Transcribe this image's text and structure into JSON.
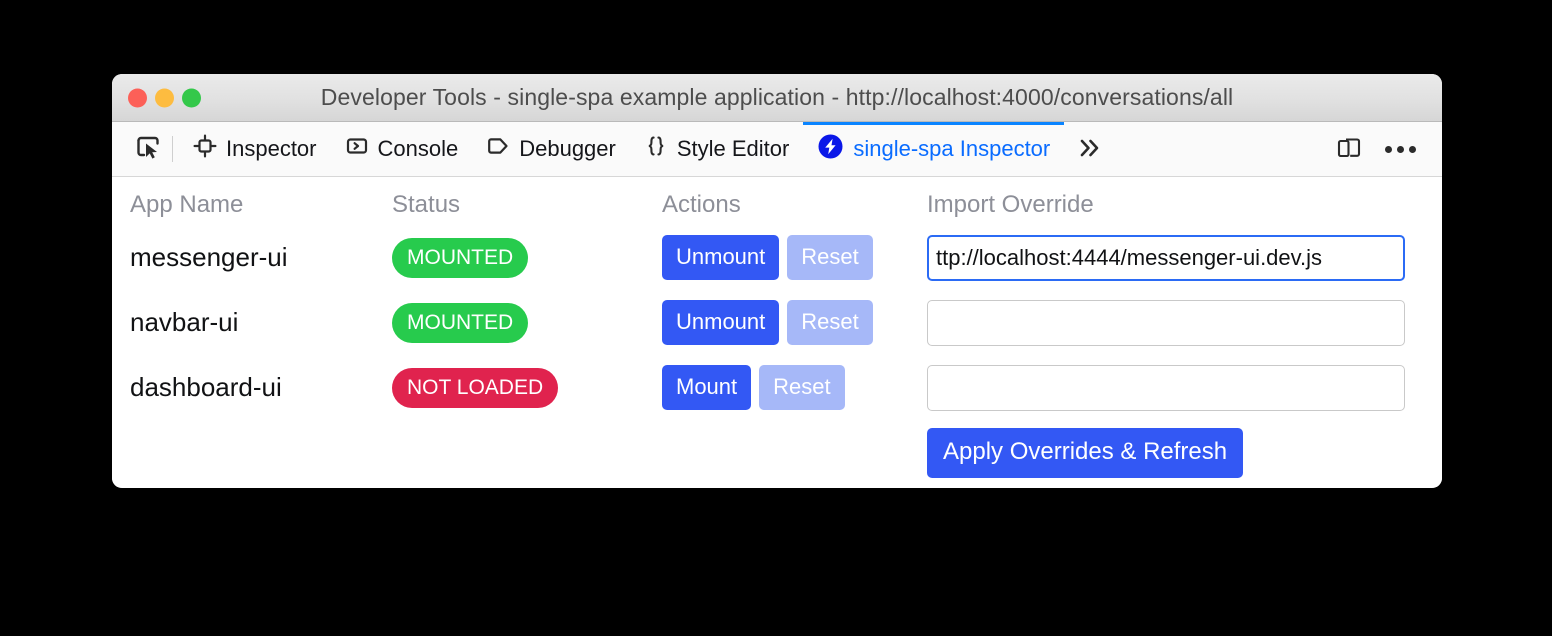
{
  "window": {
    "title": "Developer Tools - single-spa example application - http://localhost:4000/conversations/all",
    "traffic_lights": {
      "close": "close-window",
      "minimize": "minimize-window",
      "maximize": "maximize-window"
    },
    "colors": {
      "close": "#fc6058",
      "minimize": "#fdbc40",
      "maximize": "#34c84a",
      "titlebar_top": "#eaeaea",
      "titlebar_bottom": "#d6d6d6"
    }
  },
  "toolbar": {
    "picker_icon": "element-picker-icon",
    "tabs": [
      {
        "label": "Inspector",
        "icon": "inspector-target-icon",
        "active": false
      },
      {
        "label": "Console",
        "icon": "console-chevron-icon",
        "active": false
      },
      {
        "label": "Debugger",
        "icon": "debugger-tag-icon",
        "active": false
      },
      {
        "label": "Style Editor",
        "icon": "style-editor-braces-icon",
        "active": false
      },
      {
        "label": "single-spa Inspector",
        "icon": "single-spa-bolt-icon",
        "active": true
      }
    ],
    "overflow_icon": "double-chevron-right-icon",
    "responsive_icon": "responsive-design-mode-icon",
    "menu_icon": "meatball-menu-icon",
    "active_tab_color": "#0a6cff",
    "active_underline_color": "#0a84ff"
  },
  "table": {
    "headers": {
      "app_name": "App Name",
      "status": "Status",
      "actions": "Actions",
      "import_override": "Import Override"
    },
    "rows": [
      {
        "app_name": "messenger-ui",
        "status": "MOUNTED",
        "status_color": "#27cb4d",
        "action_label": "Unmount",
        "reset_label": "Reset",
        "import_value": "ttp://localhost:4444/messenger-ui.dev.js",
        "import_placeholder": "",
        "import_focused": true
      },
      {
        "app_name": "navbar-ui",
        "status": "MOUNTED",
        "status_color": "#27cb4d",
        "action_label": "Unmount",
        "reset_label": "Reset",
        "import_value": "",
        "import_placeholder": "",
        "import_focused": false
      },
      {
        "app_name": "dashboard-ui",
        "status": "NOT LOADED",
        "status_color": "#e0234e",
        "action_label": "Mount",
        "reset_label": "Reset",
        "import_value": "",
        "import_placeholder": "",
        "import_focused": false
      }
    ],
    "apply_button_label": "Apply Overrides & Refresh",
    "primary_button_color": "#3358f4",
    "disabled_button_color": "#a6b8f8"
  }
}
